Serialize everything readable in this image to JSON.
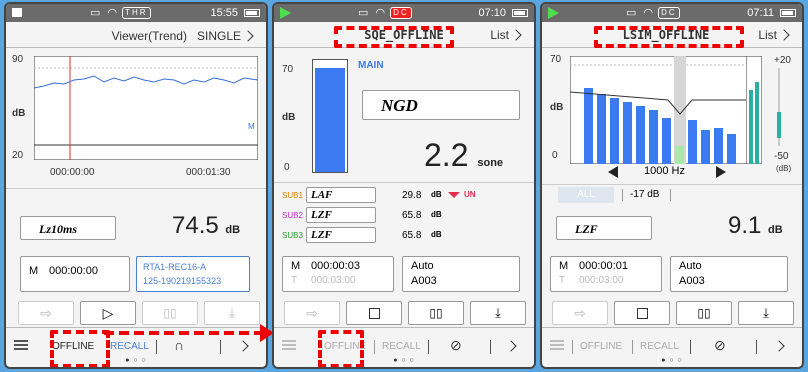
{
  "screen1": {
    "status": {
      "tag": "THR",
      "time": "15:55"
    },
    "header": {
      "title": "Viewer(Trend)",
      "mode": "SINGLE"
    },
    "graph": {
      "ymax": "90",
      "ymin": "20",
      "ylabel": "dB",
      "marker": "M",
      "t_start": "000:00:00",
      "t_end": "000:01:30"
    },
    "meter": {
      "label": "Lz10ms",
      "value": "74.5",
      "unit": "dB"
    },
    "info": {
      "m_label": "M",
      "m_time": "000:00:00",
      "file_line1": "RTA1-REC16-A",
      "file_line2": "125-190219155323"
    },
    "nav": {
      "offline": "OFFLINE",
      "recall": "RECALL"
    }
  },
  "screen2": {
    "status": {
      "tag": "DC",
      "time": "07:10"
    },
    "header": {
      "title": "SQE_OFFLINE",
      "list": "List"
    },
    "bar": {
      "ymax": "70",
      "ymin": "0",
      "ylabel": "dB",
      "main_label": "MAIN",
      "fill_fraction": 0.93
    },
    "ngd": "NGD",
    "sone": {
      "value": "2.2",
      "unit": "sone"
    },
    "subs": [
      {
        "tag": "SUB1",
        "label": "LAF",
        "value": "29.8",
        "unit": "dB",
        "extra": "UN",
        "color": "#e08000"
      },
      {
        "tag": "SUB2",
        "label": "LZF",
        "value": "65.8",
        "unit": "dB",
        "extra": "",
        "color": "#c030c0"
      },
      {
        "tag": "SUB3",
        "label": "LZF",
        "value": "65.8",
        "unit": "dB",
        "extra": "",
        "color": "#2a9a2a"
      }
    ],
    "info": {
      "m_label": "M",
      "m_time": "000:00:03",
      "t_label": "T",
      "t_time": "000:03:00",
      "mode": "Auto",
      "file": "A003"
    },
    "nav": {
      "offline": "OFFLINE",
      "recall": "RECALL"
    }
  },
  "screen3": {
    "status": {
      "tag": "DC",
      "time": "07:11"
    },
    "header": {
      "title": "LSIM_OFFLINE",
      "list": "List"
    },
    "chart": {
      "ymax": "70",
      "ymin": "0",
      "ylabel": "dB",
      "freq": "1000 Hz",
      "side_top": "+20",
      "side_bottom": "-50",
      "side_unit": "(dB)"
    },
    "tabs": {
      "all": "ALL",
      "offset": "-17 dB"
    },
    "meter": {
      "label": "LZF",
      "value": "9.1",
      "unit": "dB"
    },
    "info": {
      "m_label": "M",
      "m_time": "000:00:01",
      "t_label": "T",
      "t_time": "000:03:00",
      "mode": "Auto",
      "file": "A003"
    },
    "nav": {
      "offline": "OFFLINE",
      "recall": "RECALL"
    }
  }
}
